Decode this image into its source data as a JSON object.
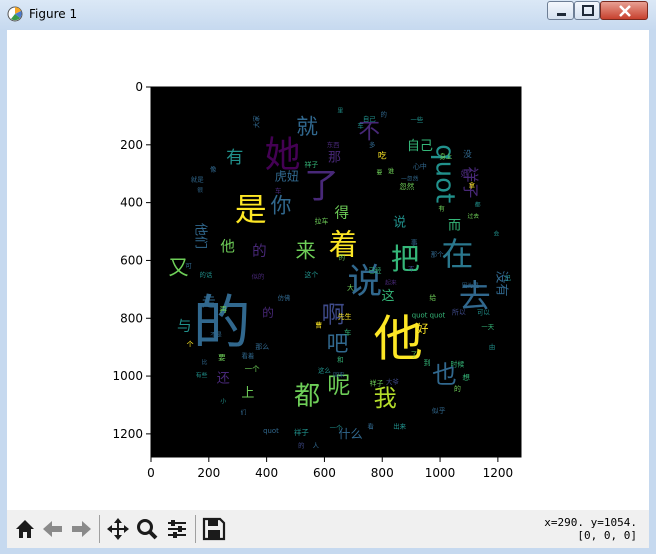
{
  "window": {
    "title": "Figure 1"
  },
  "toolbar": {
    "coords_line1": "x=290. y=1054.",
    "coords_line2": "[0, 0, 0]"
  },
  "plot": {
    "background": "#000000",
    "xlim": [
      0,
      1280
    ],
    "ylim": [
      1280,
      0
    ],
    "x_ticks": [
      "0",
      "200",
      "400",
      "600",
      "800",
      "1000",
      "1200"
    ],
    "y_ticks": [
      "0",
      "200",
      "400",
      "600",
      "800",
      "1000",
      "1200"
    ]
  },
  "wordcloud": [
    {
      "t": "的",
      "x": 245,
      "y": 815,
      "s": 200,
      "c": "#31688e"
    },
    {
      "t": "他",
      "x": 855,
      "y": 870,
      "s": 170,
      "c": "#fde725"
    },
    {
      "t": "她",
      "x": 455,
      "y": 235,
      "s": 125,
      "c": "#440154"
    },
    {
      "t": "说",
      "x": 740,
      "y": 675,
      "s": 120,
      "c": "#31688e"
    },
    {
      "t": "去",
      "x": 1120,
      "y": 725,
      "s": 110,
      "c": "#31688e"
    },
    {
      "t": "了",
      "x": 590,
      "y": 345,
      "s": 120,
      "c": "#482878"
    },
    {
      "t": "是",
      "x": 345,
      "y": 425,
      "s": 110,
      "c": "#fde725"
    },
    {
      "t": "在",
      "x": 1060,
      "y": 580,
      "s": 110,
      "c": "#2a788e"
    },
    {
      "t": "把",
      "x": 880,
      "y": 595,
      "s": 100,
      "c": "#35b779"
    },
    {
      "t": "着",
      "x": 665,
      "y": 545,
      "s": 100,
      "c": "#fde725"
    },
    {
      "t": "quot",
      "x": 1015,
      "y": 300,
      "s": 90,
      "c": "#21918c",
      "r": 90
    },
    {
      "t": "都",
      "x": 540,
      "y": 1070,
      "s": 90,
      "c": "#6ece58"
    },
    {
      "t": "我",
      "x": 810,
      "y": 1080,
      "s": 80,
      "c": "#b5de2b"
    },
    {
      "t": "也",
      "x": 1015,
      "y": 995,
      "s": 85,
      "c": "#31688e"
    },
    {
      "t": "呢",
      "x": 650,
      "y": 1035,
      "s": 80,
      "c": "#6ece58"
    },
    {
      "t": "啊",
      "x": 630,
      "y": 790,
      "s": 80,
      "c": "#3e4a89"
    },
    {
      "t": "吧",
      "x": 645,
      "y": 890,
      "s": 75,
      "c": "#31688e"
    },
    {
      "t": "就",
      "x": 540,
      "y": 140,
      "s": 75,
      "c": "#31688e"
    },
    {
      "t": "不",
      "x": 755,
      "y": 155,
      "s": 75,
      "c": "#482878"
    },
    {
      "t": "你",
      "x": 450,
      "y": 410,
      "s": 72,
      "c": "#31688e"
    },
    {
      "t": "来",
      "x": 535,
      "y": 565,
      "s": 70,
      "c": "#6ece58"
    },
    {
      "t": "祥子",
      "x": 1105,
      "y": 330,
      "s": 55,
      "c": "#482878",
      "r": 90
    },
    {
      "t": "又",
      "x": 95,
      "y": 625,
      "s": 70,
      "c": "#6ece58"
    },
    {
      "t": "有",
      "x": 290,
      "y": 245,
      "s": 60,
      "c": "#21918c"
    },
    {
      "t": "自己",
      "x": 930,
      "y": 205,
      "s": 45,
      "c": "#35b779"
    },
    {
      "t": "虎妞",
      "x": 470,
      "y": 310,
      "s": 42,
      "c": "#31688e"
    },
    {
      "t": "那",
      "x": 635,
      "y": 245,
      "s": 45,
      "c": "#482878"
    },
    {
      "t": "得",
      "x": 660,
      "y": 440,
      "s": 50,
      "c": "#6ece58"
    },
    {
      "t": "他们",
      "x": 170,
      "y": 515,
      "s": 45,
      "c": "#31688e",
      "r": 90
    },
    {
      "t": "他",
      "x": 265,
      "y": 555,
      "s": 50,
      "c": "#6ece58"
    },
    {
      "t": "的",
      "x": 375,
      "y": 570,
      "s": 50,
      "c": "#482878"
    },
    {
      "t": "走",
      "x": 200,
      "y": 745,
      "s": 48,
      "c": "#31688e"
    },
    {
      "t": "与",
      "x": 115,
      "y": 830,
      "s": 50,
      "c": "#21918c"
    },
    {
      "t": "好",
      "x": 940,
      "y": 835,
      "s": 40,
      "c": "#fde725"
    },
    {
      "t": "而",
      "x": 1050,
      "y": 480,
      "s": 45,
      "c": "#35b779"
    },
    {
      "t": "没有",
      "x": 1210,
      "y": 680,
      "s": 45,
      "c": "#31688e",
      "r": 90
    },
    {
      "t": "这",
      "x": 820,
      "y": 725,
      "s": 45,
      "c": "#35b779"
    },
    {
      "t": "上",
      "x": 335,
      "y": 1060,
      "s": 45,
      "c": "#6ece58"
    },
    {
      "t": "还",
      "x": 250,
      "y": 1010,
      "s": 45,
      "c": "#482878"
    },
    {
      "t": "什么",
      "x": 690,
      "y": 1200,
      "s": 42,
      "c": "#31688e"
    },
    {
      "t": "说",
      "x": 860,
      "y": 470,
      "s": 45,
      "c": "#21918c"
    },
    {
      "t": "的",
      "x": 405,
      "y": 780,
      "s": 40,
      "c": "#482878"
    },
    {
      "t": "心中",
      "x": 930,
      "y": 275,
      "s": 24,
      "c": "#31688e"
    },
    {
      "t": "一些",
      "x": 920,
      "y": 115,
      "s": 22,
      "c": "#21918c"
    },
    {
      "t": "时候",
      "x": 1060,
      "y": 960,
      "s": 24,
      "c": "#35b779"
    },
    {
      "t": "祥子",
      "x": 780,
      "y": 1025,
      "s": 24,
      "c": "#6ece58"
    },
    {
      "t": "quot quot",
      "x": 960,
      "y": 790,
      "s": 24,
      "c": "#35b779"
    },
    {
      "t": "quot",
      "x": 415,
      "y": 1190,
      "s": 24,
      "c": "#31688e"
    },
    {
      "t": "祥子",
      "x": 520,
      "y": 1195,
      "s": 26,
      "c": "#21918c"
    },
    {
      "t": "一个",
      "x": 640,
      "y": 1180,
      "s": 22,
      "c": "#21918c"
    },
    {
      "t": "所以",
      "x": 1065,
      "y": 780,
      "s": 24,
      "c": "#3e4a89"
    },
    {
      "t": "可以",
      "x": 1150,
      "y": 780,
      "s": 22,
      "c": "#21918c"
    },
    {
      "t": "出来",
      "x": 860,
      "y": 1175,
      "s": 22,
      "c": "#21918c"
    },
    {
      "t": "似乎",
      "x": 995,
      "y": 1120,
      "s": 24,
      "c": "#31688e"
    },
    {
      "t": "再",
      "x": 250,
      "y": 770,
      "s": 26,
      "c": "#6ece58"
    },
    {
      "t": "要",
      "x": 245,
      "y": 935,
      "s": 26,
      "c": "#6ece58"
    },
    {
      "t": "那么",
      "x": 385,
      "y": 900,
      "s": 24,
      "c": "#31688e"
    },
    {
      "t": "这个",
      "x": 555,
      "y": 650,
      "s": 24,
      "c": "#21918c"
    },
    {
      "t": "已经",
      "x": 775,
      "y": 635,
      "s": 22,
      "c": "#35b779"
    },
    {
      "t": "先生",
      "x": 670,
      "y": 795,
      "s": 24,
      "c": "#fde725"
    },
    {
      "t": "这么",
      "x": 600,
      "y": 980,
      "s": 22,
      "c": "#21918c"
    },
    {
      "t": "看着",
      "x": 335,
      "y": 930,
      "s": 22,
      "c": "#31688e"
    },
    {
      "t": "吃",
      "x": 800,
      "y": 240,
      "s": 30,
      "c": "#fde725"
    },
    {
      "t": "没",
      "x": 1095,
      "y": 235,
      "s": 30,
      "c": "#31688e"
    },
    {
      "t": "她",
      "x": 1085,
      "y": 300,
      "s": 28,
      "c": "#482878"
    },
    {
      "t": "拉车",
      "x": 590,
      "y": 465,
      "s": 24,
      "c": "#6ece58"
    },
    {
      "t": "忽然",
      "x": 885,
      "y": 345,
      "s": 26,
      "c": "#6ece58"
    },
    {
      "t": "一忽然",
      "x": 895,
      "y": 320,
      "s": 20,
      "c": "#31688e"
    },
    {
      "t": "就是",
      "x": 160,
      "y": 320,
      "s": 22,
      "c": "#31688e"
    },
    {
      "t": "一个",
      "x": 350,
      "y": 975,
      "s": 26,
      "c": "#6ece58"
    },
    {
      "t": "车",
      "x": 680,
      "y": 850,
      "s": 26,
      "c": "#35b779"
    },
    {
      "t": "大",
      "x": 690,
      "y": 695,
      "s": 24,
      "c": "#6ece58"
    },
    {
      "t": "给",
      "x": 975,
      "y": 730,
      "s": 24,
      "c": "#6ece58"
    },
    {
      "t": "想",
      "x": 1090,
      "y": 1005,
      "s": 26,
      "c": "#35b779"
    },
    {
      "t": "到",
      "x": 955,
      "y": 955,
      "s": 24,
      "c": "#35b779"
    },
    {
      "t": "事",
      "x": 910,
      "y": 540,
      "s": 24,
      "c": "#31688e"
    },
    {
      "t": "的",
      "x": 1060,
      "y": 1045,
      "s": 24,
      "c": "#6ece58"
    },
    {
      "t": "祥子",
      "x": 555,
      "y": 270,
      "s": 24,
      "c": "#35b779"
    },
    {
      "t": "身上",
      "x": 1020,
      "y": 240,
      "s": 22,
      "c": "#6ece58"
    },
    {
      "t": "个",
      "x": 135,
      "y": 890,
      "s": 24,
      "c": "#fde725"
    },
    {
      "t": "可",
      "x": 130,
      "y": 620,
      "s": 22,
      "c": "#31688e"
    },
    {
      "t": "的话",
      "x": 190,
      "y": 650,
      "s": 22,
      "c": "#21918c"
    },
    {
      "t": "似的",
      "x": 370,
      "y": 655,
      "s": 22,
      "c": "#482878"
    },
    {
      "t": "仿佛",
      "x": 460,
      "y": 730,
      "s": 22,
      "c": "#31688e"
    },
    {
      "t": "不是",
      "x": 225,
      "y": 860,
      "s": 20,
      "c": "#31688e"
    },
    {
      "t": "比",
      "x": 185,
      "y": 955,
      "s": 20,
      "c": "#31688e"
    },
    {
      "t": "有些",
      "x": 175,
      "y": 1000,
      "s": 20,
      "c": "#21918c"
    },
    {
      "t": "因为是",
      "x": 1105,
      "y": 690,
      "s": 20,
      "c": "#31688e"
    },
    {
      "t": "过去",
      "x": 1115,
      "y": 450,
      "s": 20,
      "c": "#6ece58"
    },
    {
      "t": "拿",
      "x": 1110,
      "y": 340,
      "s": 22,
      "c": "#fde725"
    },
    {
      "t": "有",
      "x": 1005,
      "y": 420,
      "s": 22,
      "c": "#6ece58"
    },
    {
      "t": "那个",
      "x": 990,
      "y": 580,
      "s": 22,
      "c": "#31688e"
    },
    {
      "t": "回来",
      "x": 650,
      "y": 1000,
      "s": 20,
      "c": "#31688e"
    },
    {
      "t": "大爷",
      "x": 835,
      "y": 1020,
      "s": 22,
      "c": "#3e4a89"
    },
    {
      "t": "曹",
      "x": 580,
      "y": 825,
      "s": 24,
      "c": "#fde725"
    },
    {
      "t": "和",
      "x": 655,
      "y": 945,
      "s": 22,
      "c": "#35b779"
    },
    {
      "t": "的",
      "x": 805,
      "y": 95,
      "s": 22,
      "c": "#31688e"
    },
    {
      "t": "看",
      "x": 760,
      "y": 1175,
      "s": 22,
      "c": "#31688e"
    },
    {
      "t": "了",
      "x": 910,
      "y": 925,
      "s": 22,
      "c": "#6ece58"
    },
    {
      "t": "一天",
      "x": 1165,
      "y": 830,
      "s": 22,
      "c": "#35b779"
    },
    {
      "t": "由",
      "x": 1180,
      "y": 900,
      "s": 22,
      "c": "#21918c"
    },
    {
      "t": "会",
      "x": 1195,
      "y": 510,
      "s": 20,
      "c": "#21918c"
    },
    {
      "t": "已",
      "x": 1235,
      "y": 660,
      "s": 22,
      "c": "#21918c"
    },
    {
      "t": "小",
      "x": 250,
      "y": 1090,
      "s": 20,
      "c": "#21918c"
    },
    {
      "t": "们",
      "x": 320,
      "y": 1130,
      "s": 20,
      "c": "#31688e"
    },
    {
      "t": "的",
      "x": 520,
      "y": 1240,
      "s": 22,
      "c": "#3e4a89"
    },
    {
      "t": "人",
      "x": 570,
      "y": 1240,
      "s": 22,
      "c": "#31688e"
    },
    {
      "t": "像",
      "x": 215,
      "y": 285,
      "s": 22,
      "c": "#31688e"
    },
    {
      "t": "很",
      "x": 170,
      "y": 360,
      "s": 20,
      "c": "#31688e"
    },
    {
      "t": "多",
      "x": 765,
      "y": 200,
      "s": 22,
      "c": "#31688e"
    },
    {
      "t": "车",
      "x": 725,
      "y": 135,
      "s": 22,
      "c": "#21918c"
    },
    {
      "t": "里",
      "x": 655,
      "y": 85,
      "s": 20,
      "c": "#21918c"
    },
    {
      "t": "自己",
      "x": 755,
      "y": 110,
      "s": 22,
      "c": "#21918c"
    },
    {
      "t": "大家",
      "x": 365,
      "y": 120,
      "s": 22,
      "c": "#31688e",
      "r": -90
    },
    {
      "t": "东西",
      "x": 630,
      "y": 200,
      "s": 22,
      "c": "#482878"
    },
    {
      "t": "要",
      "x": 790,
      "y": 300,
      "s": 20,
      "c": "#6ece58"
    },
    {
      "t": "谁",
      "x": 830,
      "y": 290,
      "s": 22,
      "c": "#6ece58"
    },
    {
      "t": "的",
      "x": 660,
      "y": 590,
      "s": 22,
      "c": "#6ece58"
    },
    {
      "t": "起来",
      "x": 830,
      "y": 680,
      "s": 20,
      "c": "#482878"
    },
    {
      "t": "不",
      "x": 900,
      "y": 630,
      "s": 22,
      "c": "#3e4a89"
    },
    {
      "t": "都",
      "x": 1130,
      "y": 410,
      "s": 20,
      "c": "#21918c"
    },
    {
      "t": "车",
      "x": 440,
      "y": 360,
      "s": 22,
      "c": "#482878"
    }
  ]
}
